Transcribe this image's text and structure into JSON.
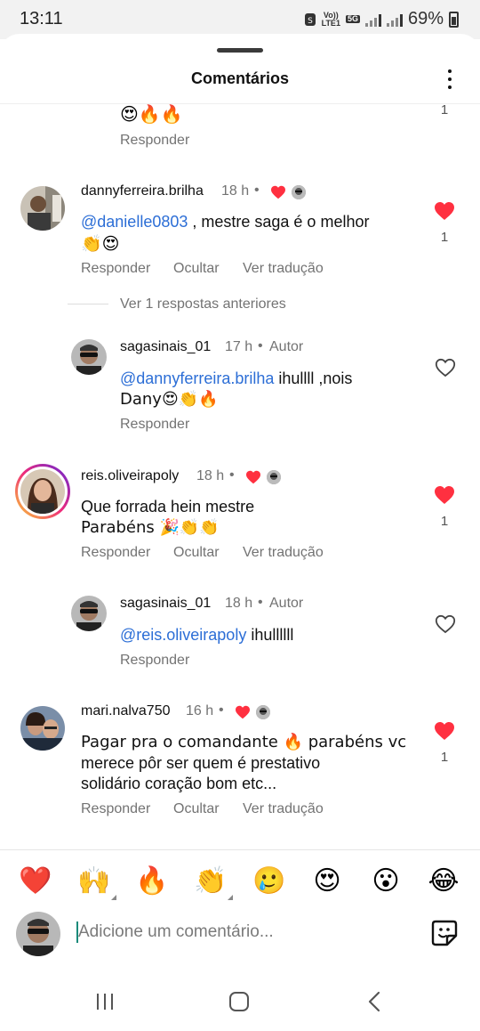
{
  "status": {
    "time": "13:11",
    "volte": "Vo))",
    "lte": "LTE1",
    "net": "5G",
    "battery": "69%"
  },
  "sheet": {
    "title": "Comentários"
  },
  "top_partial": {
    "emojis": "😍🔥🔥",
    "reply": "Responder",
    "likes": "1"
  },
  "comments": [
    {
      "username": "dannyferreira.brilha",
      "time": "18 h",
      "mention": "@danielle0803",
      "text": " , mestre saga é o melhor",
      "text2": "👏😍",
      "reply": "Responder",
      "hide": "Ocultar",
      "translate": "Ver tradução",
      "likes": "1",
      "liked": true
    },
    {
      "username": "reis.oliveirapoly",
      "time": "18 h",
      "line1": "Que forrada hein mestre",
      "line2": "Parabéns 🎉👏👏",
      "reply": "Responder",
      "hide": "Ocultar",
      "translate": "Ver tradução",
      "likes": "1",
      "liked": true
    },
    {
      "username": "mari.nalva750",
      "time": "16 h",
      "line1": "Pagar pra o comandante 🔥 parabéns vc",
      "line2": "merece pôr ser quem é prestativo",
      "line3": "solidário coração bom etc...",
      "reply": "Responder",
      "hide": "Ocultar",
      "translate": "Ver tradução",
      "likes": "1",
      "liked": true
    }
  ],
  "view_previous": "Ver 1 respostas anteriores",
  "replies": [
    {
      "username": "sagasinais_01",
      "time": "17 h",
      "author": "Autor",
      "mention": "@dannyferreira.brilha",
      "text": " ihullll ,nois",
      "text2": "Dany😍👏🔥",
      "reply": "Responder"
    },
    {
      "username": "sagasinais_01",
      "time": "18 h",
      "author": "Autor",
      "mention": "@reis.oliveirapoly",
      "text": " ihullllll",
      "reply": "Responder"
    }
  ],
  "reactions": [
    "❤️",
    "🙌",
    "🔥",
    "👏",
    "🥲",
    "😍",
    "😮",
    "😂"
  ],
  "composer": {
    "placeholder": "Adicione um comentário..."
  },
  "colors": {
    "like_red": "#ff3040",
    "mention_blue": "#2c6ed6",
    "meta_gray": "#737373"
  }
}
